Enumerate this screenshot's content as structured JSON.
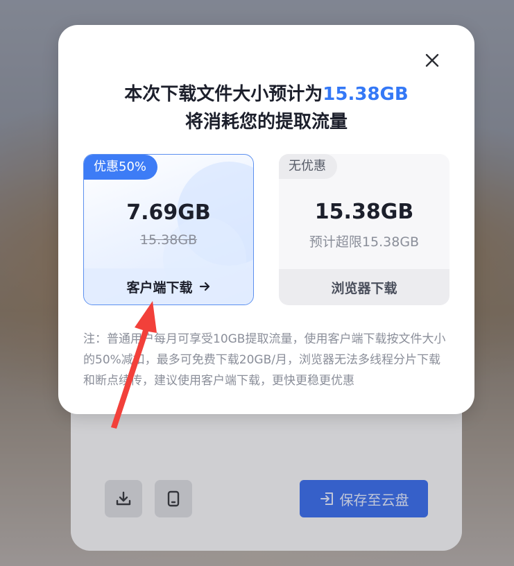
{
  "modal": {
    "title_line1_prefix": "本次下载文件大小预计为",
    "title_line1_highlight": "15.38GB",
    "title_line2": "将消耗您的提取流量",
    "close_icon": "close-icon"
  },
  "client_card": {
    "badge": "优惠50%",
    "size": "7.69GB",
    "original_size": "15.38GB",
    "action_label": "客户端下载",
    "action_icon": "arrow-right-icon"
  },
  "browser_card": {
    "badge": "无优惠",
    "size": "15.38GB",
    "note": "预计超限15.38GB",
    "action_label": "浏览器下载"
  },
  "footnote": "注：普通用户每月可享受10GB提取流量，使用客户端下载按文件大小的50%减扣，最多可免费下载20GB/月，浏览器无法多线程分片下载和断点续传，建议使用客户端下载，更快更稳更优惠",
  "background_panel": {
    "save_button_label": "保存至云盘",
    "download_icon": "download-icon",
    "tablet_icon": "tablet-icon"
  },
  "colors": {
    "accent": "#3478f6",
    "badge_blue": "#3d7cf6",
    "save_button": "#2f64e8",
    "annotation_arrow": "#f2403a"
  }
}
